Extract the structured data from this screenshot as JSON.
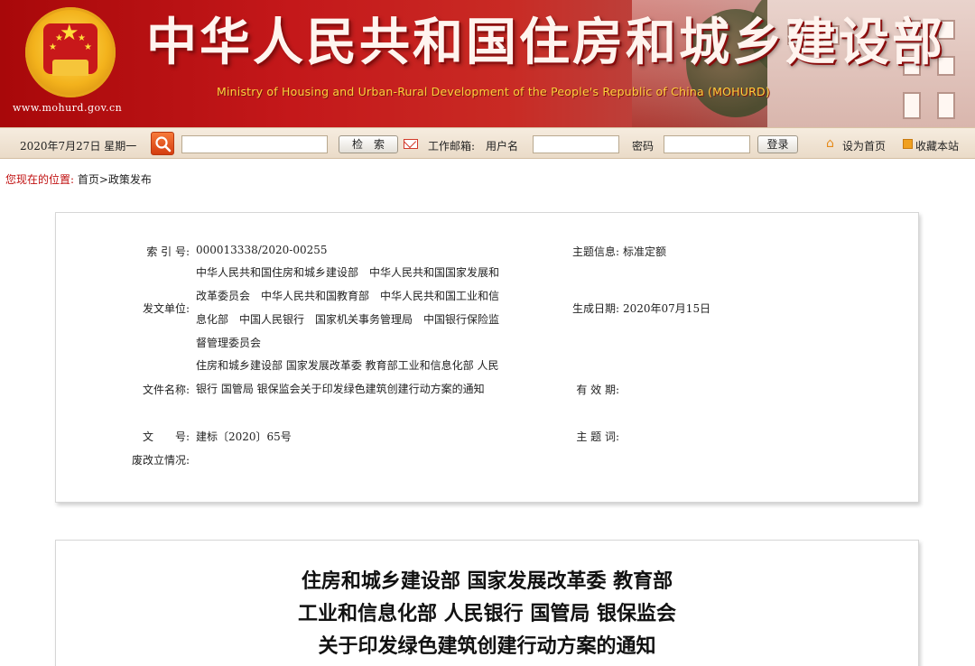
{
  "banner": {
    "title": "中华人民共和国住房和城乡建设部",
    "subtitle": "Ministry of Housing and Urban-Rural Development of the People's Republic of China (MOHURD)",
    "url": "www.mohurd.gov.cn",
    "emblem_icon": "national-emblem-icon"
  },
  "toolbar": {
    "date": "2020年7月27日 星期一",
    "search_button": "检　索",
    "mail_label": "工作邮箱:",
    "username_label": "用户名",
    "password_label": "密码",
    "login_button": "登录",
    "set_home": "设为首页",
    "bookmark": "收藏本站",
    "search_value": "",
    "username_value": "",
    "password_value": ""
  },
  "breadcrumb": {
    "label": "您现在的位置:",
    "path": "首页>政策发布"
  },
  "info": {
    "index_label": "索 引 号:",
    "index_value": "000013338/2020-00255",
    "topic_label": "主题信息:",
    "topic_value": "标准定额",
    "issuer_label": "发文单位:",
    "issuer_value": "中华人民共和国住房和城乡建设部　中华人民共和国国家发展和改革委员会　中华人民共和国教育部　中华人民共和国工业和信息化部　中国人民银行　国家机关事务管理局　中国银行保险监督管理委员会",
    "date_label": "生成日期:",
    "date_value": "2020年07月15日",
    "filename_label": "文件名称:",
    "filename_value": "住房和城乡建设部 国家发展改革委 教育部工业和信息化部 人民银行 国管局 银保监会关于印发绿色建筑创建行动方案的通知",
    "validity_label": "有 效 期:",
    "validity_value": "",
    "docno_label": "文　　号:",
    "docno_value": "建标〔2020〕65号",
    "keywords_label": "主 题 词:",
    "keywords_value": "",
    "status_label": "废改立情况:",
    "status_value": ""
  },
  "document": {
    "title_lines": [
      "住房和城乡建设部 国家发展改革委 教育部",
      "工业和信息化部 人民银行 国管局 银保监会",
      "关于印发绿色建筑创建行动方案的通知"
    ]
  },
  "colors": {
    "banner_red": "#c4181a",
    "breadcrumb_red": "#c01010",
    "subtitle_gold": "#ffd23c",
    "toolbar_bg": "#f0e3d3"
  }
}
